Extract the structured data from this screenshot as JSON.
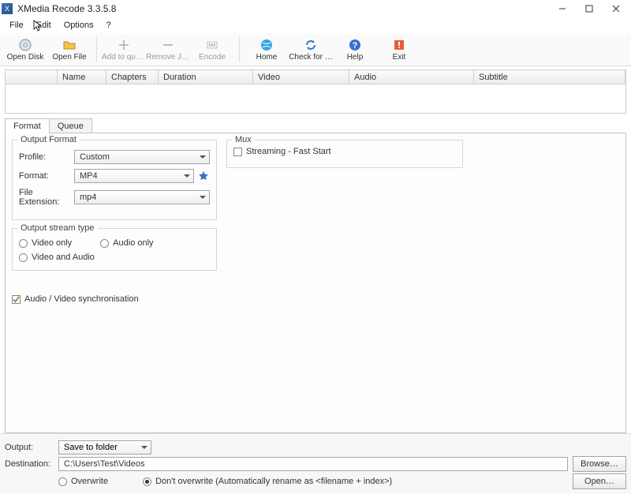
{
  "titlebar": {
    "title": "XMedia Recode 3.3.5.8"
  },
  "menubar": {
    "file": "File",
    "edit": "Edit",
    "options": "Options",
    "help": "?"
  },
  "toolbar": {
    "open_disk": "Open Disk",
    "open_file": "Open File",
    "add_queue": "Add to que…",
    "remove_job": "Remove Job",
    "encode": "Encode",
    "home": "Home",
    "check_update": "Check for …",
    "help": "Help",
    "exit": "Exit"
  },
  "grid": {
    "cols": {
      "name": "Name",
      "chapters": "Chapters",
      "duration": "Duration",
      "video": "Video",
      "audio": "Audio",
      "subtitle": "Subtitle"
    }
  },
  "tabs": {
    "format": "Format",
    "queue": "Queue"
  },
  "format": {
    "output_format_legend": "Output Format",
    "profile_label": "Profile:",
    "profile_value": "Custom",
    "format_label": "Format:",
    "format_value": "MP4",
    "ext_label": "File Extension:",
    "ext_value": "mp4",
    "stream_legend": "Output stream type",
    "video_only": "Video only",
    "audio_only": "Audio only",
    "video_audio": "Video and Audio",
    "av_sync": "Audio / Video synchronisation",
    "mux_legend": "Mux",
    "streaming": "Streaming - Fast Start"
  },
  "bottom": {
    "output_label": "Output:",
    "output_value": "Save to folder",
    "dest_label": "Destination:",
    "dest_value": "C:\\Users\\Test\\Videos",
    "browse": "Browse…",
    "overwrite": "Overwrite",
    "dont_overwrite": "Don't overwrite (Automatically rename as <filename + index>)",
    "open": "Open…"
  }
}
